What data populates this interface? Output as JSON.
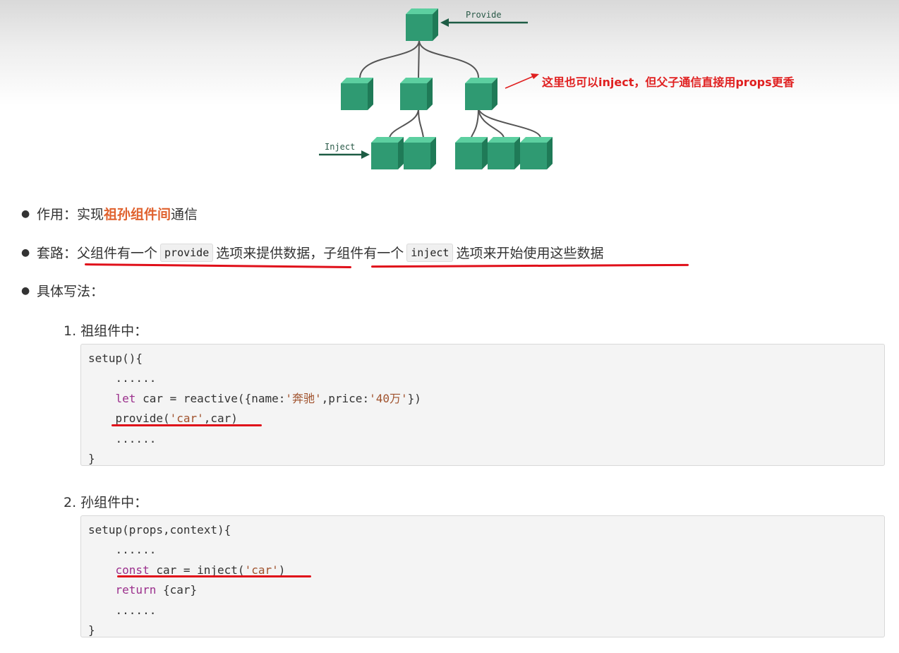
{
  "diagram": {
    "provide_label": "Provide",
    "inject_label": "Inject",
    "annotation": "这里也可以inject，但父子通信直接用props更香",
    "colors": {
      "cube": "#2f9a72",
      "arrow": "#1d5c44",
      "annotation": "#e02020"
    }
  },
  "bullets": {
    "purpose": {
      "label": "作用：实现",
      "highlight": "祖孙组件间",
      "tail": "通信"
    },
    "pattern": {
      "label": "套路：",
      "part1": "父组件有一个",
      "code1": "provide",
      "part2": "选项来提供数据，",
      "part3": "子组件有一个",
      "code2": "inject",
      "part4": "选项来开始使用这些数据"
    },
    "syntax": {
      "label": "具体写法："
    }
  },
  "steps": [
    {
      "title": "1. 祖组件中：",
      "code": {
        "l1": "setup(){",
        "l2": "    ......",
        "l3_kw": "let",
        "l3_a": " car = reactive({name:",
        "l3_s1": "'奔驰'",
        "l3_b": ",price:",
        "l3_s2": "'40万'",
        "l3_c": "})",
        "l4_a": "provide(",
        "l4_s": "'car'",
        "l4_b": ",car)",
        "l5": "    ......",
        "l6": "}"
      }
    },
    {
      "title": "2. 孙组件中：",
      "code": {
        "l1": "setup(props,context){",
        "l2": "    ......",
        "l3_kw": "const",
        "l3_a": " car = inject(",
        "l3_s": "'car'",
        "l3_b": ")",
        "l4_kw": "return",
        "l4_a": " {car}",
        "l5": "    ......",
        "l6": "}"
      }
    }
  ],
  "colors": {
    "highlight": "#e0622f",
    "underline": "#e0101a",
    "keyword": "#9b2f8c",
    "string": "#a0522d"
  }
}
